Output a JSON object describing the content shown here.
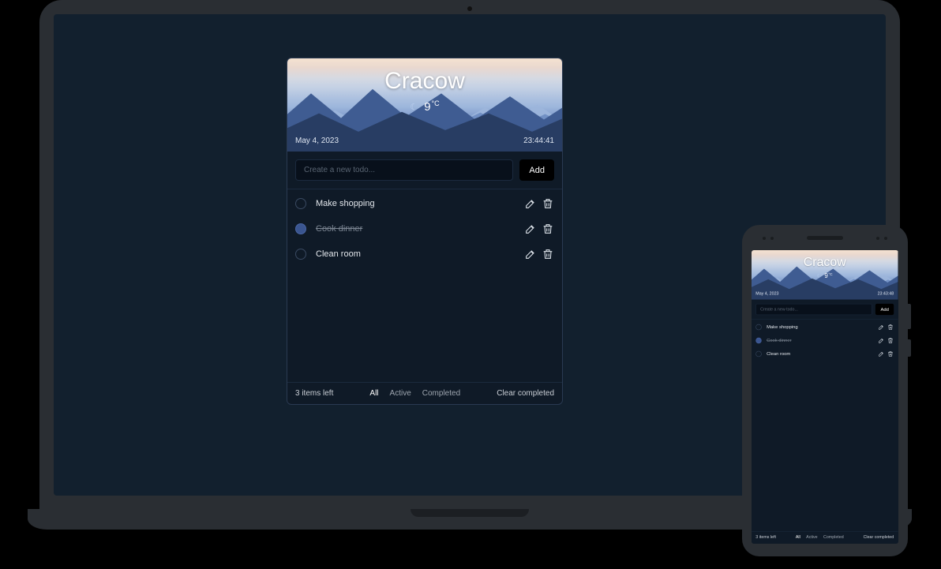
{
  "header": {
    "city": "Cracow",
    "temp_value": "9",
    "temp_unit": "°C",
    "icon": "moon"
  },
  "laptop": {
    "date": "May 4, 2023",
    "time": "23:44:41"
  },
  "phone": {
    "date": "May 4, 2023",
    "time": "23:43:48"
  },
  "input": {
    "placeholder": "Create a new todo...",
    "add_label": "Add"
  },
  "todos": [
    {
      "label": "Make shopping",
      "done": false
    },
    {
      "label": "Cook dinner",
      "done": true
    },
    {
      "label": "Clean room",
      "done": false
    }
  ],
  "footer": {
    "count_text": "3 items left",
    "filters": {
      "all": "All",
      "active": "Active",
      "completed": "Completed"
    },
    "active_filter": "all",
    "clear_label": "Clear completed"
  },
  "colors": {
    "screen_bg": "#12202e",
    "card_bg": "#0f1a27",
    "border": "#2a3a52",
    "accent": "#3a5590"
  }
}
